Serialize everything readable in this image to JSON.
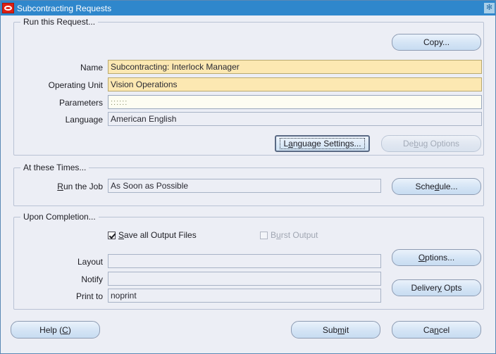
{
  "window": {
    "title": "Subcontracting Requests",
    "logo_icon": "oracle-logo-icon",
    "close_icon": "close-icon",
    "close_glyph": "✻"
  },
  "run_request": {
    "group_title": "Run this Request...",
    "copy_button": "Copy...",
    "fields": [
      {
        "label": "Name",
        "value": "Subcontracting: Interlock Manager",
        "style": "required"
      },
      {
        "label": "Operating Unit",
        "value": "Vision Operations",
        "style": "required"
      },
      {
        "label": "Parameters",
        "value": "::::::",
        "style": "editable"
      },
      {
        "label": "Language",
        "value": "American English",
        "style": "readonly"
      }
    ],
    "language_settings_button": {
      "pre": "L",
      "mnemonic": "a",
      "post": "nguage Settings..."
    },
    "debug_options_button": {
      "pre": "De",
      "mnemonic": "b",
      "post": "ug Options",
      "disabled": true
    }
  },
  "at_these_times": {
    "group_title": "At these Times...",
    "run_the_job_label": {
      "mnemonic": "R",
      "post": "un the Job"
    },
    "run_the_job_value": "As Soon as Possible",
    "schedule_button": {
      "pre": "Sche",
      "mnemonic": "d",
      "post": "ule..."
    }
  },
  "upon_completion": {
    "group_title": "Upon Completion...",
    "save_all_output_files": {
      "pre": "",
      "mnemonic": "S",
      "post": "ave all Output Files",
      "checked": true,
      "disabled": false
    },
    "burst_output": {
      "pre": "B",
      "mnemonic": "u",
      "post": "rst Output",
      "checked": false,
      "disabled": true
    },
    "fields": [
      {
        "label": "Layout",
        "value": "",
        "style": "readonly"
      },
      {
        "label": "Notify",
        "value": "",
        "style": "readonly"
      },
      {
        "label": "Print to",
        "value": "noprint",
        "style": "readonly"
      }
    ],
    "options_button": {
      "pre": "",
      "mnemonic": "O",
      "post": "ptions..."
    },
    "delivery_opts_button": {
      "pre": "Deliver",
      "mnemonic": "y",
      "post": " Opts"
    }
  },
  "footer": {
    "help_button": {
      "pre": "Help (",
      "mnemonic": "C",
      "post": ")"
    },
    "submit_button": {
      "pre": "Sub",
      "mnemonic": "m",
      "post": "it"
    },
    "cancel_button": {
      "pre": "Ca",
      "mnemonic": "n",
      "post": "cel"
    }
  },
  "colors": {
    "titlebar": "#2f87cc",
    "panel": "#eceef5",
    "required_field": "#fce8b2",
    "button": "#d4e4f5",
    "oracle_red": "#dd1f13"
  }
}
